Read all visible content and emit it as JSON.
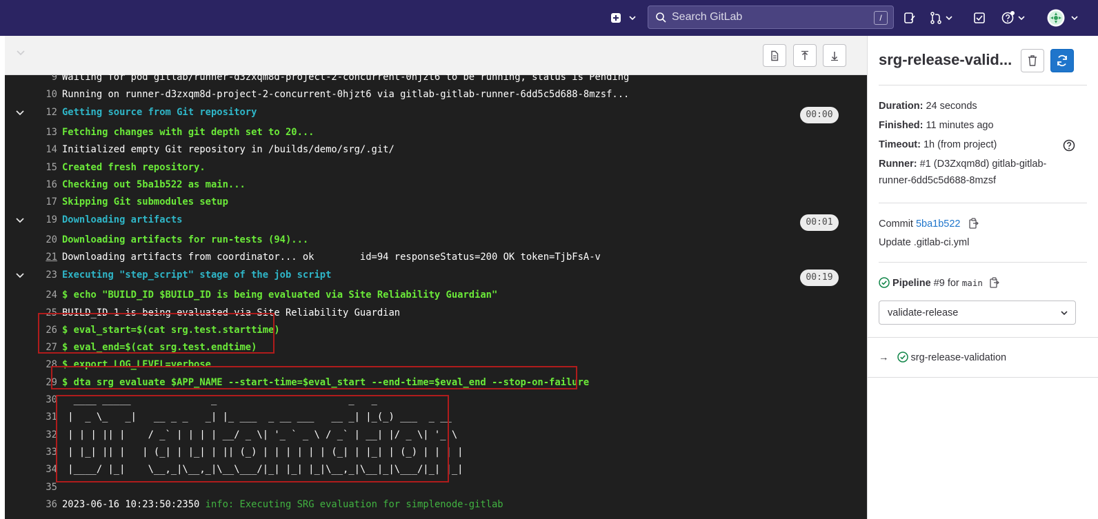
{
  "topbar": {
    "search_placeholder": "Search GitLab",
    "search_shortcut": "/"
  },
  "log_toolbar": {
    "collapse_icon": "chevron-down-icon",
    "buttons": [
      "raw-log-icon",
      "scroll-top-icon",
      "scroll-bottom-icon"
    ]
  },
  "log": {
    "lines": [
      {
        "n": "9",
        "text": "Waiting for pod gitlab/runner-d3zxqm8d-project-2-concurrent-0hjzt6 to be running, status is Pending",
        "style": "w"
      },
      {
        "n": "10",
        "text": "Running on runner-d3zxqm8d-project-2-concurrent-0hjzt6 via gitlab-gitlab-runner-6dd5c5d688-8mzsf...",
        "style": "w"
      },
      {
        "n": "12",
        "text": "Getting source from Git repository",
        "style": "c",
        "section": true,
        "duration": "00:00"
      },
      {
        "n": "13",
        "text": "Fetching changes with git depth set to 20...",
        "style": "g"
      },
      {
        "n": "14",
        "text": "Initialized empty Git repository in /builds/demo/srg/.git/",
        "style": "w"
      },
      {
        "n": "15",
        "text": "Created fresh repository.",
        "style": "g"
      },
      {
        "n": "16",
        "text": "Checking out 5ba1b522 as main...",
        "style": "g"
      },
      {
        "n": "17",
        "text": "Skipping Git submodules setup",
        "style": "g"
      },
      {
        "n": "19",
        "text": "Downloading artifacts",
        "style": "c",
        "section": true,
        "duration": "00:01"
      },
      {
        "n": "20",
        "text": "Downloading artifacts for run-tests (94)...",
        "style": "g"
      },
      {
        "n": "21",
        "text": "Downloading artifacts from coordinator... ok        id=94 responseStatus=200 OK token=TjbFsA-v",
        "style": "w",
        "underline": true
      },
      {
        "n": "23",
        "text": "Executing \"step_script\" stage of the job script",
        "style": "c",
        "section": true,
        "duration": "00:19"
      },
      {
        "n": "24",
        "text": "$ echo \"BUILD_ID $BUILD_ID is being evaluated via Site Reliability Guardian\"",
        "style": "g"
      },
      {
        "n": "25",
        "text": "BUILD_ID 1 is being evaluated via Site Reliability Guardian",
        "style": "w"
      },
      {
        "n": "26",
        "text": "$ eval_start=$(cat srg.test.starttime)",
        "style": "g"
      },
      {
        "n": "27",
        "text": "$ eval_end=$(cat srg.test.endtime)",
        "style": "g"
      },
      {
        "n": "28",
        "text": "$ export LOG_LEVEL=verbose",
        "style": "g"
      },
      {
        "n": "29",
        "text": "$ dta srg evaluate $APP_NAME --start-time=$eval_start --end-time=$eval_end --stop-on-failure",
        "style": "g"
      },
      {
        "n": "30",
        "text": "  ____ _____              _                       _   _",
        "style": "w"
      },
      {
        "n": "31",
        "text": " |  _ \\_   _|   __ _ _   _| |_ ___  _ __ ___   __ _| |_(_) ___  _ __",
        "style": "w"
      },
      {
        "n": "32",
        "text": " | | | || |    / _` | | | | __/ _ \\| '_ ` _ \\ / _` | __| |/ _ \\| '_ \\",
        "style": "w"
      },
      {
        "n": "33",
        "text": " | |_| || |   | (_| | |_| | || (_) | | | | | | (_| | |_| | (_) | | | |",
        "style": "w"
      },
      {
        "n": "34",
        "text": " |____/ |_|    \\__,_|\\__,_|\\__\\___/|_| |_| |_|\\__,_|\\__|_|\\___/|_| |_|",
        "style": "w"
      },
      {
        "n": "35",
        "text": "",
        "style": "w"
      },
      {
        "n": "36",
        "text": "2023-06-16 10:23:50:2350 ",
        "style": "w",
        "info_label": "info",
        "info_msg": ": Executing SRG evaluation for simplenode-gitlab"
      }
    ]
  },
  "sidebar": {
    "title": "srg-release-valid...",
    "duration_label": "Duration:",
    "duration_value": " 24 seconds",
    "finished_label": "Finished:",
    "finished_value": " 11 minutes ago",
    "timeout_label": "Timeout:",
    "timeout_value": " 1h (from project)",
    "runner_label": "Runner:",
    "runner_value": " #1 (D3Zxqm8d) gitlab-gitlab-runner-6dd5c5d688-8mzsf",
    "commit_label": "Commit ",
    "commit_sha": "5ba1b522",
    "commit_message": "Update .gitlab-ci.yml",
    "pipeline_label": "Pipeline",
    "pipeline_number": " #9 for ",
    "pipeline_branch": "main",
    "stage_select": "validate-release",
    "job_arrow": "→",
    "job_name": "srg-release-validation"
  },
  "colors": {
    "topbar": "#2b2462",
    "log_bg": "#1f1f1f",
    "log_green": "#6bea39",
    "log_cyan": "#2fb6c8",
    "highlight_box": "#b01c1c",
    "accent_blue": "#1f75cb",
    "success_green": "#108548"
  }
}
